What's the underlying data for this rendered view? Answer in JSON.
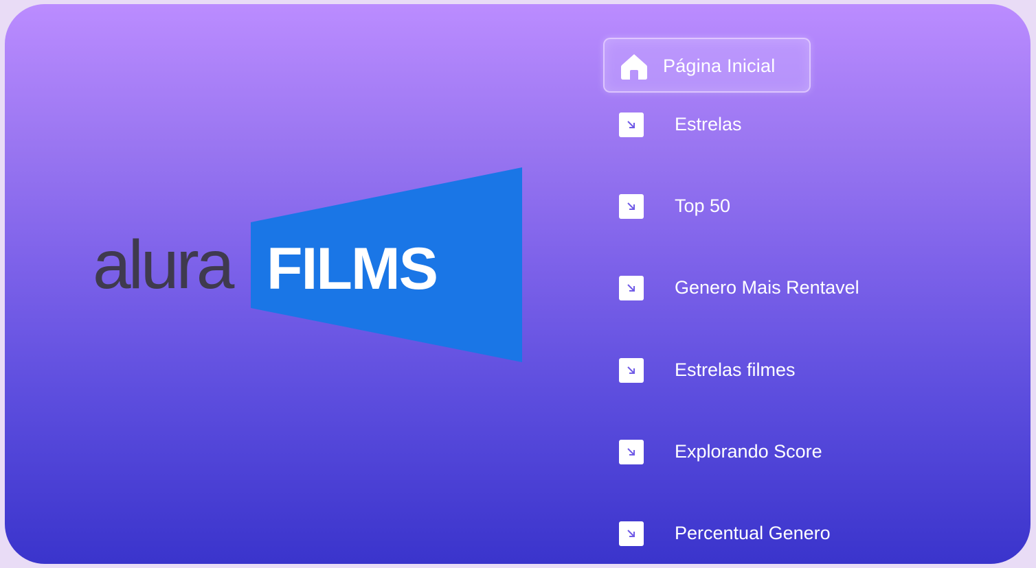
{
  "logo": {
    "brand_word": "alura",
    "product_word": "FILMS",
    "brand_color": "#3f3a4e",
    "banner_color": "#1a76e6"
  },
  "nav": {
    "home": {
      "label": "Página Inicial",
      "icon": "home-icon"
    },
    "items": [
      {
        "label": "Estrelas",
        "icon": "arrow-down-right-icon"
      },
      {
        "label": "Top 50",
        "icon": "arrow-down-right-icon"
      },
      {
        "label": "Genero Mais Rentavel",
        "icon": "arrow-down-right-icon"
      },
      {
        "label": "Estrelas filmes",
        "icon": "arrow-down-right-icon"
      },
      {
        "label": "Explorando Score",
        "icon": "arrow-down-right-icon"
      },
      {
        "label": "Percentual Genero",
        "icon": "arrow-down-right-icon"
      }
    ]
  },
  "colors": {
    "gradient_top": "#bb8cff",
    "gradient_bottom": "#3a34cc",
    "icon_arrow": "#6f5ae6"
  }
}
